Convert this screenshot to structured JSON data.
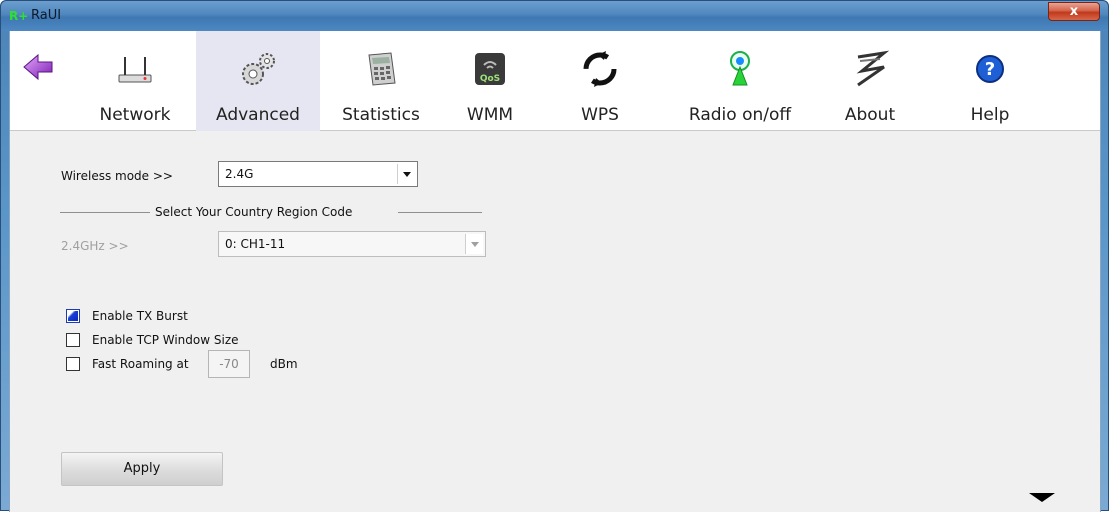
{
  "window": {
    "title": "RaUI",
    "app_icon_glyph": "R+",
    "close_glyph": "x"
  },
  "toolbar": {
    "items": [
      {
        "label": "Network",
        "icon": "router-icon"
      },
      {
        "label": "Advanced",
        "icon": "gears-icon"
      },
      {
        "label": "Statistics",
        "icon": "calculator-icon"
      },
      {
        "label": "WMM",
        "icon": "qos-icon"
      },
      {
        "label": "WPS",
        "icon": "wps-icon"
      },
      {
        "label": "Radio on/off",
        "icon": "radio-antenna-icon"
      },
      {
        "label": "About",
        "icon": "about-logo-icon"
      },
      {
        "label": "Help",
        "icon": "help-icon"
      }
    ],
    "active": "Advanced",
    "back_icon": "back-arrow-icon"
  },
  "form": {
    "wireless_mode_label": "Wireless mode >>",
    "wireless_mode_value": "2.4G",
    "region_section_title": "Select Your Country Region Code",
    "band_label": "2.4GHz >>",
    "band_value": "0: CH1-11",
    "tx_burst_label": "Enable TX Burst",
    "tx_burst_checked": true,
    "tcp_window_label": "Enable TCP Window Size",
    "tcp_window_checked": false,
    "fast_roaming_label": "Fast Roaming at",
    "fast_roaming_checked": false,
    "fast_roaming_value": "-70",
    "fast_roaming_unit": "dBm",
    "apply_label": "Apply"
  },
  "colors": {
    "accent": "#2a5fa0",
    "checkbox_fill": "#0b2ab8",
    "close": "#c0391b"
  }
}
